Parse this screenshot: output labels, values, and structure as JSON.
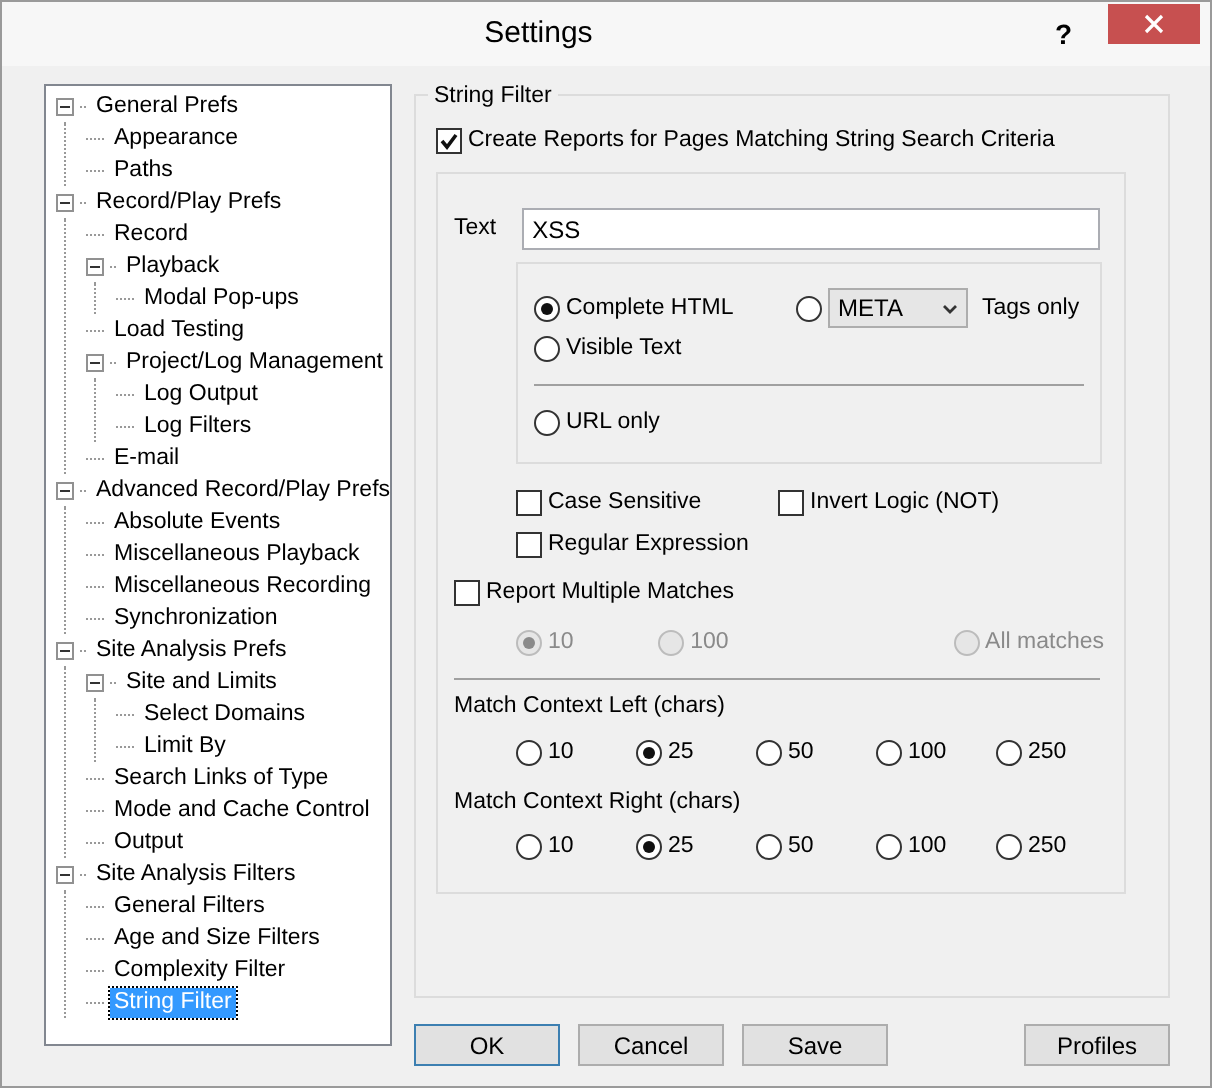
{
  "window": {
    "title": "Settings",
    "help": "?"
  },
  "tree": [
    {
      "label": "General Prefs",
      "expanded": true,
      "selected": false,
      "children": [
        {
          "label": "Appearance",
          "selected": false
        },
        {
          "label": "Paths",
          "selected": false
        }
      ]
    },
    {
      "label": "Record/Play Prefs",
      "expanded": true,
      "selected": false,
      "children": [
        {
          "label": "Record",
          "selected": false
        },
        {
          "label": "Playback",
          "expanded": true,
          "selected": false,
          "children": [
            {
              "label": "Modal Pop-ups",
              "selected": false
            }
          ]
        },
        {
          "label": "Load Testing",
          "selected": false
        },
        {
          "label": "Project/Log Management",
          "expanded": true,
          "selected": false,
          "children": [
            {
              "label": "Log Output",
              "selected": false
            },
            {
              "label": "Log Filters",
              "selected": false
            }
          ]
        },
        {
          "label": "E-mail",
          "selected": false
        }
      ]
    },
    {
      "label": "Advanced Record/Play Prefs",
      "expanded": true,
      "selected": false,
      "children": [
        {
          "label": "Absolute Events",
          "selected": false
        },
        {
          "label": "Miscellaneous Playback",
          "selected": false
        },
        {
          "label": "Miscellaneous Recording",
          "selected": false
        },
        {
          "label": "Synchronization",
          "selected": false
        }
      ]
    },
    {
      "label": "Site Analysis Prefs",
      "expanded": true,
      "selected": false,
      "children": [
        {
          "label": "Site and Limits",
          "expanded": true,
          "selected": false,
          "children": [
            {
              "label": "Select Domains",
              "selected": false
            },
            {
              "label": "Limit By",
              "selected": false
            }
          ]
        },
        {
          "label": "Search Links of Type",
          "selected": false
        },
        {
          "label": "Mode and Cache Control",
          "selected": false
        },
        {
          "label": "Output",
          "selected": false
        }
      ]
    },
    {
      "label": "Site Analysis Filters",
      "expanded": true,
      "selected": false,
      "children": [
        {
          "label": "General Filters",
          "selected": false
        },
        {
          "label": "Age and Size Filters",
          "selected": false
        },
        {
          "label": "Complexity Filter",
          "selected": false
        },
        {
          "label": "String Filter",
          "selected": true
        }
      ]
    }
  ],
  "string_filter": {
    "title": "String Filter",
    "enable": {
      "label": "Create Reports for Pages Matching String Search Criteria",
      "checked": true
    },
    "text_label": "Text",
    "text_value": "XSS",
    "scope_options": [
      {
        "kind": "radio",
        "label": "Complete HTML",
        "selected": true
      },
      {
        "kind": "tag",
        "select_value": "META",
        "label": "Tags only",
        "selected": false
      },
      {
        "kind": "radio",
        "label": "Visible Text",
        "selected": false
      },
      {
        "kind": "radio",
        "label": "URL only",
        "selected": false
      }
    ],
    "options": [
      {
        "label": "Case Sensitive",
        "checked": false
      },
      {
        "label": "Invert Logic (NOT)",
        "checked": false
      },
      {
        "label": "Regular Expression",
        "checked": false
      }
    ],
    "multiple": {
      "label": "Report Multiple Matches",
      "checked": false,
      "choices": [
        {
          "label": "10",
          "selected": true,
          "disabled": true
        },
        {
          "label": "100",
          "selected": false,
          "disabled": true
        },
        {
          "label": "All matches",
          "selected": false,
          "disabled": true
        }
      ]
    },
    "contexts": [
      {
        "label": "Match Context Left (chars)",
        "choices": [
          {
            "label": "10",
            "selected": false
          },
          {
            "label": "25",
            "selected": true
          },
          {
            "label": "50",
            "selected": false
          },
          {
            "label": "100",
            "selected": false
          },
          {
            "label": "250",
            "selected": false
          }
        ]
      },
      {
        "label": "Match Context Right (chars)",
        "choices": [
          {
            "label": "10",
            "selected": false
          },
          {
            "label": "25",
            "selected": true
          },
          {
            "label": "50",
            "selected": false
          },
          {
            "label": "100",
            "selected": false
          },
          {
            "label": "250",
            "selected": false
          }
        ]
      }
    ]
  },
  "buttons": [
    {
      "label": "OK",
      "default": true
    },
    {
      "label": "Cancel",
      "default": false
    },
    {
      "label": "Save",
      "default": false
    },
    {
      "label": "Profiles",
      "default": false
    }
  ]
}
